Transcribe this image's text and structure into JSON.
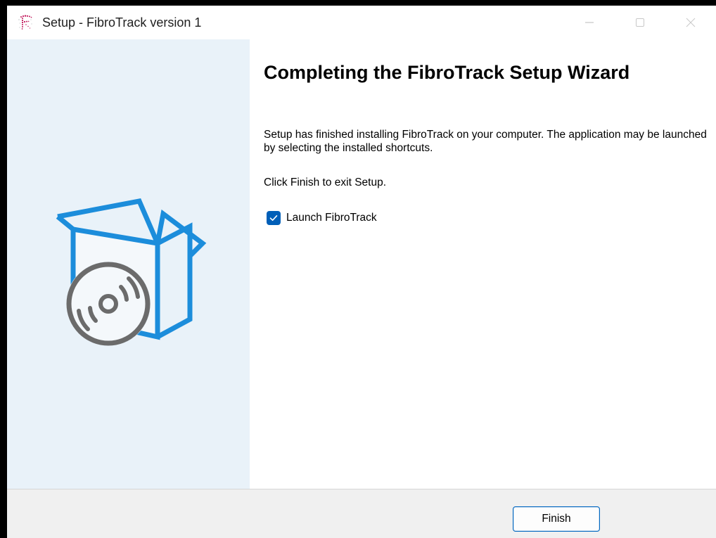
{
  "window": {
    "title": "Setup - FibroTrack version 1",
    "controls": {
      "minimize": "minimize-icon",
      "maximize": "maximize-icon",
      "close": "close-icon"
    }
  },
  "sidebar": {
    "artwork": "box-with-disc-icon"
  },
  "content": {
    "heading": "Completing the FibroTrack Setup Wizard",
    "description": "Setup has finished installing FibroTrack on your computer. The application may be launched by selecting the installed shortcuts.",
    "exit_hint": "Click Finish to exit Setup.",
    "launch_option": {
      "label": "Launch FibroTrack",
      "checked": true
    }
  },
  "footer": {
    "finish_label": "Finish"
  },
  "colors": {
    "sidebar_bg": "#e9f2f9",
    "accent": "#0067c0",
    "checkbox": "#005fb8",
    "art_blue": "#1c8ddb",
    "art_gray": "#6b6b6b",
    "brand_pink": "#c2185b"
  }
}
